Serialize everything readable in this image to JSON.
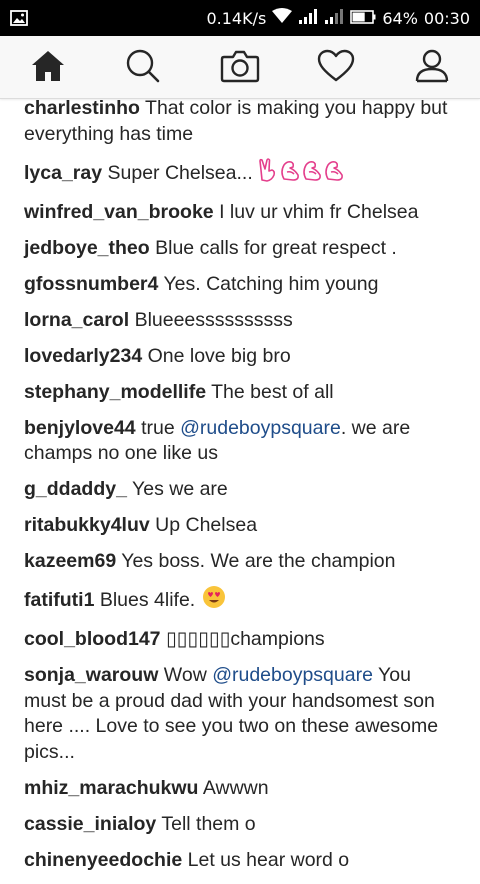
{
  "status_bar": {
    "speed": "0.14K/s",
    "battery_percent": "64%",
    "battery_level": 0.64,
    "time": "00:30"
  },
  "tab_bar": {
    "tabs": [
      {
        "icon": "home-icon",
        "active": true
      },
      {
        "icon": "search-icon",
        "active": false
      },
      {
        "icon": "camera-icon",
        "active": false
      },
      {
        "icon": "heart-icon",
        "active": false
      },
      {
        "icon": "profile-icon",
        "active": false
      }
    ]
  },
  "comments": [
    {
      "user": "charlestinho",
      "text": "That color is making you happy but everything has time"
    },
    {
      "user": "lyca_ray",
      "text": "Super Chelsea...",
      "emoji": "✌💪💪💪"
    },
    {
      "user": "winfred_van_brooke",
      "text": "I luv ur vhim fr Chelsea"
    },
    {
      "user": "jedboye_theo",
      "text": "Blue calls for great respect ."
    },
    {
      "user": "gfossnumber4",
      "text": "Yes. Catching him young"
    },
    {
      "user": "lorna_carol",
      "text": "Blueeessssssssss"
    },
    {
      "user": "lovedarly234",
      "text": "One love big bro"
    },
    {
      "user": "stephany_modellife",
      "text": "The best of all"
    },
    {
      "user": "benjylove44",
      "text_before": "true ",
      "mention": "@rudeboypsquare",
      "text_after": ". we are champs no one like us"
    },
    {
      "user": "g_ddaddy_",
      "text": "Yes we are"
    },
    {
      "user": "ritabukky4luv",
      "text": "Up Chelsea"
    },
    {
      "user": "kazeem69",
      "text": "Yes boss. We are the champion"
    },
    {
      "user": "fatifuti1",
      "text": "Blues 4life.",
      "emoji": "😍"
    },
    {
      "user": "cool_blood147",
      "text": "▯▯▯▯▯▯champions"
    },
    {
      "user": "sonja_warouw",
      "text_before": "Wow ",
      "mention": "@rudeboypsquare",
      "text_after": " You must be a proud dad with your handsomest son here .... Love to see you two on these awesome pics..."
    },
    {
      "user": "mhiz_marachukwu",
      "text": "Awwwn"
    },
    {
      "user": "cassie_inialoy",
      "text": "Tell them o"
    },
    {
      "user": "chinenyeedochie",
      "text": "Let us hear word o"
    }
  ]
}
